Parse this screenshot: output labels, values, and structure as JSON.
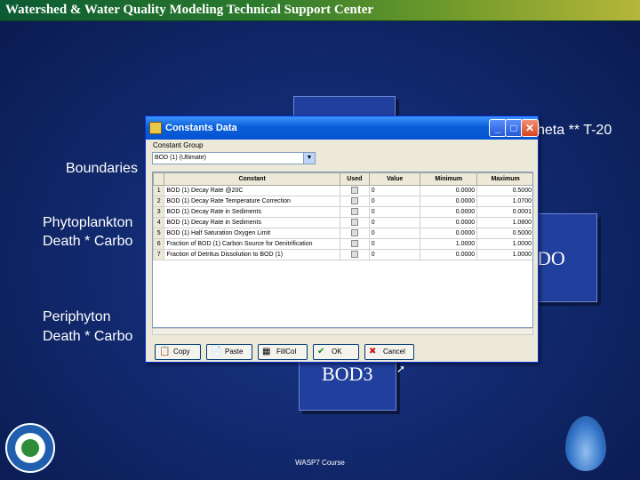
{
  "slide": {
    "header": "Watershed & Water Quality Modeling Technical Support Center",
    "text_theta": "heta ** T-20",
    "text_boundaries": "Boundaries",
    "text_phyto_1": "Phytoplankton",
    "text_phyto_2": "Death * Carbo",
    "text_peri_1": "Periphyton",
    "text_peri_2": "Death * Carbo",
    "box_do": "DO",
    "box_bod3": "BOD3",
    "footer": "WASP7 Course"
  },
  "dialog": {
    "title": "Constants Data",
    "group_label": "Constant Group",
    "group_value": "BOD (1) (Ultimate)",
    "columns": [
      "",
      "Constant",
      "Used",
      "Value",
      "Minimum",
      "Maximum"
    ],
    "rows": [
      {
        "n": "1",
        "constant": "BOD (1) Decay Rate @20C",
        "value": "0",
        "min": "0.0000",
        "max": "0.5000"
      },
      {
        "n": "2",
        "constant": "BOD (1) Decay Rate Temperature Correction",
        "value": "0",
        "min": "0.0000",
        "max": "1.0700"
      },
      {
        "n": "3",
        "constant": "BOD (1) Decay Rate in Sediments",
        "value": "0",
        "min": "0.0000",
        "max": "0.0001"
      },
      {
        "n": "4",
        "constant": "BOD (1) Decay Rate in Sediments",
        "value": "0",
        "min": "0.0000",
        "max": "1.0800"
      },
      {
        "n": "5",
        "constant": "BOD (1) Half Saturation Oxygen Limit",
        "value": "0",
        "min": "0.0000",
        "max": "0.5000"
      },
      {
        "n": "6",
        "constant": "Fraction of BOD (1) Carbon Source for Denitrification",
        "value": "0",
        "min": "1.0000",
        "max": "1.0000"
      },
      {
        "n": "7",
        "constant": "Fraction of Detritus Dissolution to BOD (1)",
        "value": "0",
        "min": "0.0000",
        "max": "1.0000"
      }
    ],
    "buttons": {
      "copy": "Copy",
      "paste": "Paste",
      "fill": "FillCol",
      "ok": "OK",
      "cancel": "Cancel"
    }
  }
}
